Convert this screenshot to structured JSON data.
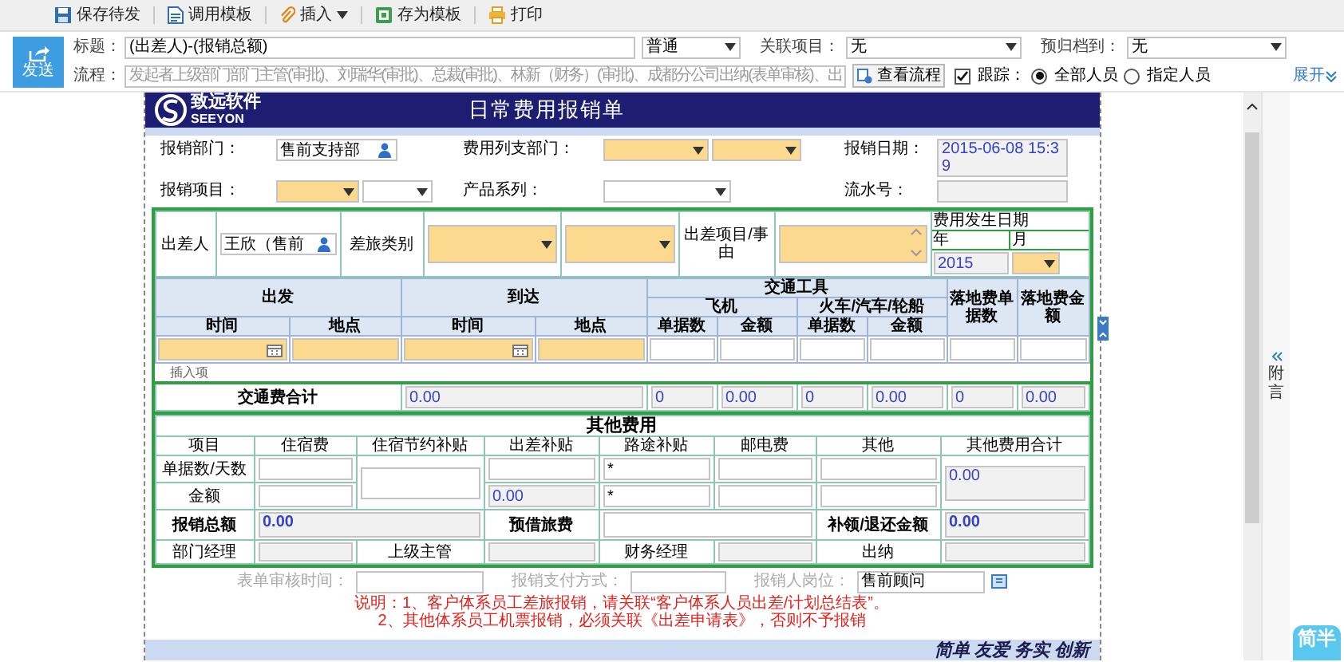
{
  "toolbar": [
    {
      "label": "保存待发",
      "kind": "button"
    },
    {
      "label": "调用模板",
      "kind": "button"
    },
    {
      "label": "插入",
      "kind": "menu"
    },
    {
      "label": "存为模板",
      "kind": "button"
    },
    {
      "label": "打印",
      "kind": "button"
    }
  ],
  "send_button": "发送",
  "subject": {
    "label": "标题：",
    "field": {
      "kind": "input",
      "required": false,
      "value": "(出差人)-(报销总额)"
    }
  },
  "priority": {
    "kind": "select",
    "required": false,
    "value": "普通"
  },
  "related": {
    "label": "关联项目：",
    "field": {
      "kind": "select",
      "required": false,
      "value": "无"
    }
  },
  "archive": {
    "label": "预归档到：",
    "field": {
      "kind": "select",
      "required": false,
      "value": "无"
    }
  },
  "flow": {
    "label": "流程：",
    "placeholder": "发起者上级部门部门主管(审批)、刘瑞华(审批)、总裁(审批)、林新（财务）(审批)、成都分公司出纳(表单审核)、出",
    "button": "查看流程"
  },
  "track": {
    "label": "跟踪：",
    "checked": true
  },
  "scope": [
    {
      "label": "全部人员",
      "selected": true
    },
    {
      "label": "指定人员",
      "selected": false
    }
  ],
  "expand": "展开",
  "form": {
    "logo": {
      "name": "致远软件",
      "latin": "SEEYON"
    },
    "title": "日常费用报销单",
    "info": [
      {
        "label": "报销部门：",
        "fields": [
          {
            "kind": "input",
            "required": false,
            "value": "售前支持部",
            "picker": true
          }
        ]
      },
      {
        "label": "费用列支部门：",
        "fields": [
          {
            "kind": "select",
            "required": true
          },
          {
            "kind": "select",
            "required": true
          }
        ]
      },
      {
        "label": "报销日期：",
        "fields": [
          {
            "kind": "computed",
            "value": "2015-06-08 15:39"
          }
        ]
      },
      {
        "label": "报销项目：",
        "fields": [
          {
            "kind": "select",
            "required": true
          },
          {
            "kind": "select",
            "required": false
          }
        ]
      },
      {
        "label": "产品系列：",
        "fields": [
          {
            "kind": "select",
            "required": false
          }
        ]
      },
      {
        "label": "流水号：",
        "fields": [
          {
            "kind": "computed"
          }
        ]
      }
    ],
    "trip": {
      "traveler_label": "出差人",
      "traveler": {
        "kind": "input",
        "required": false,
        "value": "王欣（售前",
        "picker": true
      },
      "type_label": "差旅类别",
      "type_fields": [
        {
          "kind": "select",
          "required": true
        },
        {
          "kind": "select",
          "required": true
        }
      ],
      "purpose_label": "出差项目/事由",
      "purpose": {
        "kind": "textarea",
        "required": true
      },
      "date_label": "费用发生日期",
      "year_label": "年",
      "month_label": "月",
      "year": {
        "kind": "computed",
        "value": "2015"
      },
      "month": {
        "kind": "select",
        "required": true
      }
    },
    "transport": {
      "depart": "出发",
      "arrive": "到达",
      "vehicle": "交通工具",
      "plane": "飞机",
      "train": "火车/汽车/轮船",
      "landing_count": "落地费单据数",
      "landing_amount": "落地费金额",
      "subheaders": [
        "时间",
        "地点",
        "时间",
        "地点",
        "单据数",
        "金额",
        "单据数",
        "金额"
      ],
      "fields": [
        {
          "kind": "date",
          "required": true
        },
        {
          "kind": "input",
          "required": true
        },
        {
          "kind": "date",
          "required": true
        },
        {
          "kind": "input",
          "required": true
        },
        {
          "kind": "input",
          "required": false
        },
        {
          "kind": "input",
          "required": false
        },
        {
          "kind": "input",
          "required": false
        },
        {
          "kind": "input",
          "required": false
        },
        {
          "kind": "input",
          "required": false
        },
        {
          "kind": "input",
          "required": false
        }
      ],
      "insert_link": "插入项",
      "total_label": "交通费合计",
      "totals": [
        "0.00",
        "0",
        "0.00",
        "0",
        "0.00",
        "0",
        "0.00"
      ]
    },
    "other": {
      "title": "其他费用",
      "columns": [
        "项目",
        "住宿费",
        "住宿节约补贴",
        "出差补贴",
        "路途补贴",
        "邮电费",
        "其他",
        "其他费用合计"
      ],
      "row_labels": [
        "单据数/天数",
        "金额"
      ],
      "count_fields": [
        {
          "kind": "input",
          "required": false
        },
        {
          "kind": "input",
          "required": false
        },
        {
          "kind": "input",
          "required": false
        },
        {
          "kind": "input",
          "required": false,
          "value": "*"
        },
        {
          "kind": "input",
          "required": false
        },
        {
          "kind": "input",
          "required": false
        },
        {
          "kind": "computed",
          "value": "0.00"
        }
      ],
      "amount_fields": [
        {
          "kind": "input",
          "required": false
        },
        {
          "kind": "computed",
          "value": "0.00"
        },
        {
          "kind": "input",
          "required": false,
          "value": "*"
        },
        {
          "kind": "input",
          "required": false
        },
        {
          "kind": "input",
          "required": false
        }
      ]
    },
    "summary": [
      {
        "label": "报销总额",
        "field": {
          "kind": "computed",
          "value": "0.00"
        }
      },
      {
        "label": "预借旅费",
        "field": {
          "kind": "input",
          "required": false
        }
      },
      {
        "label": "补领/退还金额",
        "field": {
          "kind": "computed",
          "value": "0.00"
        }
      }
    ],
    "approvals": [
      {
        "label": "部门经理"
      },
      {
        "label": "上级主管"
      },
      {
        "label": "财务经理"
      },
      {
        "label": "出纳"
      }
    ],
    "audit": [
      {
        "label": "表单审核时间：",
        "field": {
          "kind": "input",
          "required": false
        }
      },
      {
        "label": "报销支付方式：",
        "field": {
          "kind": "input",
          "required": false
        }
      },
      {
        "label": "报销人岗位：",
        "field": {
          "kind": "input",
          "required": false,
          "value": "售前顾问"
        }
      }
    ],
    "notes": [
      "说明：1、客户体系员工差旅报销，请关联“客户体系人员出差/计划总结表”。",
      "2、其他体系员工机票报销，必须关联《出差申请表》，否则不予报销"
    ],
    "slogan": "简单 友爱 务实 创新"
  },
  "side_panel": "附言",
  "badge": "简半"
}
